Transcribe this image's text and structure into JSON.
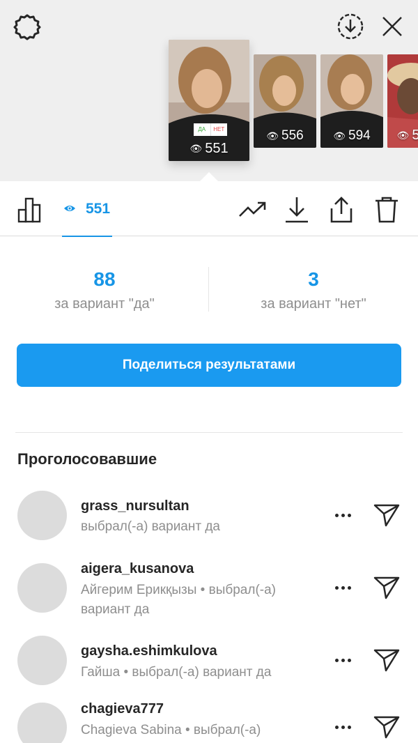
{
  "header": {
    "icons": [
      "settings-gear-icon",
      "download-circle-icon",
      "close-icon"
    ]
  },
  "stories": [
    {
      "views": "551",
      "selected": true,
      "sticker_yes": "ДА",
      "sticker_no": "НЕТ"
    },
    {
      "views": "556",
      "selected": false
    },
    {
      "views": "594",
      "selected": false
    },
    {
      "views": "5",
      "selected": false
    }
  ],
  "toolbar": {
    "views_count": "551",
    "icons": [
      "stats-chart-icon",
      "eye-icon",
      "trend-arrow-icon",
      "download-icon",
      "share-icon",
      "trash-icon"
    ]
  },
  "poll": {
    "yes_count": "88",
    "yes_label": "за вариант \"да\"",
    "no_count": "3",
    "no_label": "за вариант \"нет\""
  },
  "share_button_label": "Поделиться результатами",
  "voters_title": "Проголосовавшие",
  "voters": [
    {
      "username": "grass_nursultan",
      "subtitle": "выбрал(-а) вариант да"
    },
    {
      "username": "aigera_kusanova",
      "subtitle": "Айгерим Ерикқызы • выбрал(-а) вариант да"
    },
    {
      "username": "gaysha.eshimkulova",
      "subtitle": "Гайша • выбрал(-а) вариант да"
    },
    {
      "username": "chagieva777",
      "subtitle": "Chagieva Sabina • выбрал(-а)"
    }
  ],
  "colors": {
    "accent": "#1795e6",
    "button": "#1a9af0",
    "muted": "#8e8e8e",
    "text": "#262626"
  }
}
